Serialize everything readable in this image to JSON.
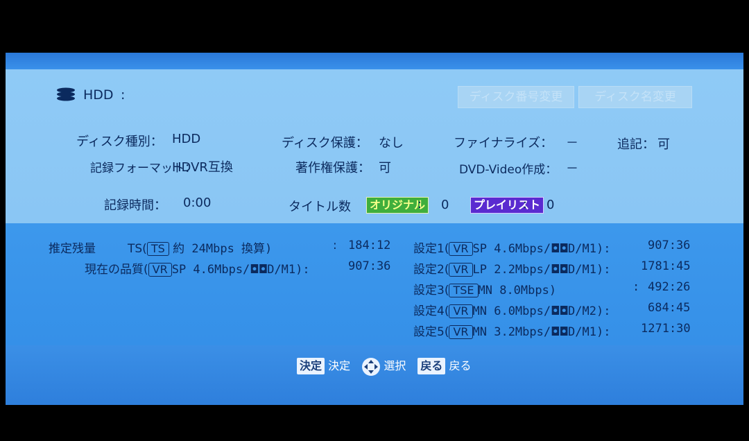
{
  "header": {
    "device": "HDD",
    "device_colon": ":",
    "buttons": {
      "rename_number": "ディスク番号変更",
      "rename_disc": "ディスク名変更"
    }
  },
  "info": {
    "disc_type_label": "ディスク種別：",
    "disc_type_value": "HDD",
    "record_format_label": "記録フォーマット：",
    "record_format_value": "HDVR互換",
    "disc_protect_label": "ディスク保護：",
    "disc_protect_value": "なし",
    "copyright_label": "著作権保護：",
    "copyright_value": "可",
    "finalize_label": "ファイナライズ：",
    "finalize_value": "－",
    "dvd_video_label": "DVD-Video作成：",
    "dvd_video_value": "－",
    "append_label": "追記：",
    "append_value": "可",
    "rec_time_label": "記録時間：",
    "rec_time_value": "0:00",
    "titles_label": "タイトル数",
    "original_badge": "オリジナル",
    "original_colon": ":",
    "original_count": "0",
    "playlist_badge": "プレイリスト",
    "playlist_colon": ":",
    "playlist_count": "0"
  },
  "remaining": {
    "label": "推定残量",
    "ts_line": {
      "mode": "TS(",
      "box": "TS",
      "text": "約 24Mbps 換算)",
      "colon": ":",
      "time": "184:12"
    },
    "current_line": {
      "label": "現在の品質(",
      "box": "VR",
      "text": "SP 4.6Mbps/",
      "dd": "◘◘",
      "suffix": "D/M1):",
      "time": "907:36"
    },
    "settings": [
      {
        "label": "設定1(",
        "box": "VR",
        "text": "SP 4.6Mbps/",
        "dd": "◘◘",
        "suffix": "D/M1):",
        "time": "907:36"
      },
      {
        "label": "設定2(",
        "box": "VR",
        "text": "LP 2.2Mbps/",
        "dd": "◘◘",
        "suffix": "D/M1):",
        "time": "1781:45"
      },
      {
        "label": "設定3(",
        "box": "TSE",
        "text": "MN 8.0Mbps)",
        "dd": "",
        "suffix": ":",
        "time": "492:26"
      },
      {
        "label": "設定4(",
        "box": "VR",
        "text": "MN 6.0Mbps/",
        "dd": "◘◘",
        "suffix": "D/M2):",
        "time": "684:45"
      },
      {
        "label": "設定5(",
        "box": "VR",
        "text": "MN 3.2Mbps/",
        "dd": "◘◘",
        "suffix": "D/M1):",
        "time": "1271:30"
      }
    ]
  },
  "nav": {
    "enter_key": "決定",
    "enter_text": "決定",
    "select_text": "選択",
    "back_key": "戻る",
    "back_text": "戻る"
  }
}
